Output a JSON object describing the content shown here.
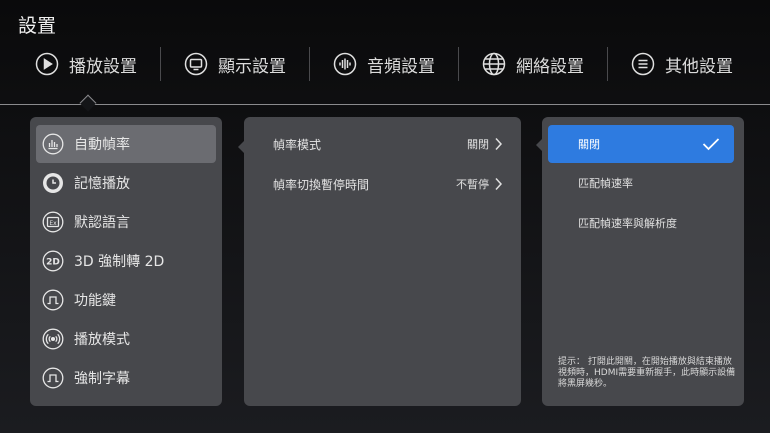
{
  "page": {
    "title": "設置"
  },
  "tabs": [
    {
      "label": "播放設置",
      "icon": "play-circle-icon"
    },
    {
      "label": "顯示設置",
      "icon": "monitor-icon"
    },
    {
      "label": "音頻設置",
      "icon": "audio-wave-icon"
    },
    {
      "label": "網絡設置",
      "icon": "globe-icon"
    },
    {
      "label": "其他設置",
      "icon": "menu-lines-icon"
    }
  ],
  "menu": [
    {
      "label": "自動幀率",
      "icon": "bar-chart-icon"
    },
    {
      "label": "記憶播放",
      "icon": "clock-icon"
    },
    {
      "label": "默認語言",
      "icon": "language-icon"
    },
    {
      "label": "3D 強制轉 2D",
      "icon": "2d-icon"
    },
    {
      "label": "功能鍵",
      "icon": "pulse-key-icon"
    },
    {
      "label": "播放模式",
      "icon": "broadcast-icon"
    },
    {
      "label": "強制字幕",
      "icon": "subtitle-icon"
    }
  ],
  "settings": [
    {
      "label": "幀率模式",
      "value": "關閉"
    },
    {
      "label": "幀率切換暫停時間",
      "value": "不暫停"
    }
  ],
  "options": [
    {
      "label": "關閉"
    },
    {
      "label": "匹配幀速率"
    },
    {
      "label": "匹配幀速率與解析度"
    }
  ],
  "hint": "提示： 打開此開關，在開始播放與結束播放視頻時，HDMI需要重新握手，此時顯示設備將黑屏幾秒。",
  "colors": {
    "accent": "#2e7be0",
    "panel": "#47484c",
    "active_item": "#6b6c71"
  }
}
